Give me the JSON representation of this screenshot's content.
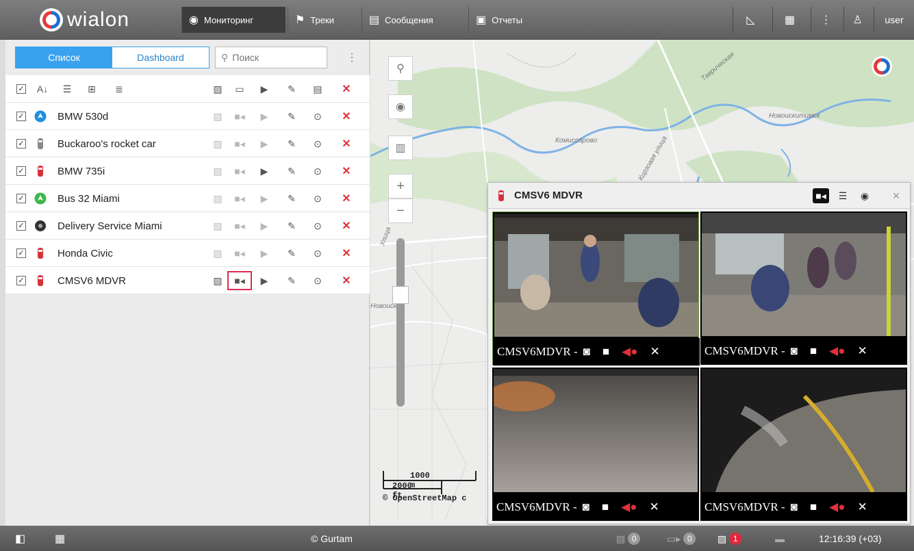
{
  "topbar": {
    "logo_text": "wialon",
    "nav": [
      {
        "label": "Мониторинг",
        "icon": "globe-icon"
      },
      {
        "label": "Треки",
        "icon": "flag-icon"
      },
      {
        "label": "Сообщения",
        "icon": "messages-icon"
      },
      {
        "label": "Отчеты",
        "icon": "report-icon"
      }
    ],
    "user_label": "user"
  },
  "sidebar": {
    "tabs": [
      {
        "label": "Список"
      },
      {
        "label": "Dashboard"
      }
    ],
    "search_placeholder": "Поиск",
    "units": [
      {
        "name": "BMW 530d",
        "icon": "circle-arrow-blue"
      },
      {
        "name": "Buckaroo's rocket car",
        "icon": "car-gray"
      },
      {
        "name": "BMW 735i",
        "icon": "car-red"
      },
      {
        "name": "Bus 32 Miami",
        "icon": "circle-arrow-green"
      },
      {
        "name": "Delivery Service Miami",
        "icon": "tire-dark"
      },
      {
        "name": "Honda Civic",
        "icon": "car-red"
      },
      {
        "name": "CMSV6 MDVR",
        "icon": "car-red"
      }
    ]
  },
  "map": {
    "labels": [
      "Таврическая",
      "Новоискитимск",
      "Комиссарово",
      "Кирзовая улица",
      "Улица",
      "Новоиск"
    ],
    "scale_m": "1000 m",
    "scale_ft": "2000 ft",
    "attribution": "© OpenStreetMap c"
  },
  "video": {
    "title": "CMSV6 MDVR",
    "feeds": [
      {
        "caption": "CMSV6MDVR -"
      },
      {
        "caption": "CMSV6MDVR -"
      },
      {
        "caption": "CMSV6MDVR -"
      },
      {
        "caption": "CMSV6MDVR -"
      }
    ]
  },
  "bottombar": {
    "copyright": "© Gurtam",
    "badge_messages": "0",
    "badge_commands": "0",
    "badge_images": "1",
    "time": "12:16:39 (+03)"
  }
}
